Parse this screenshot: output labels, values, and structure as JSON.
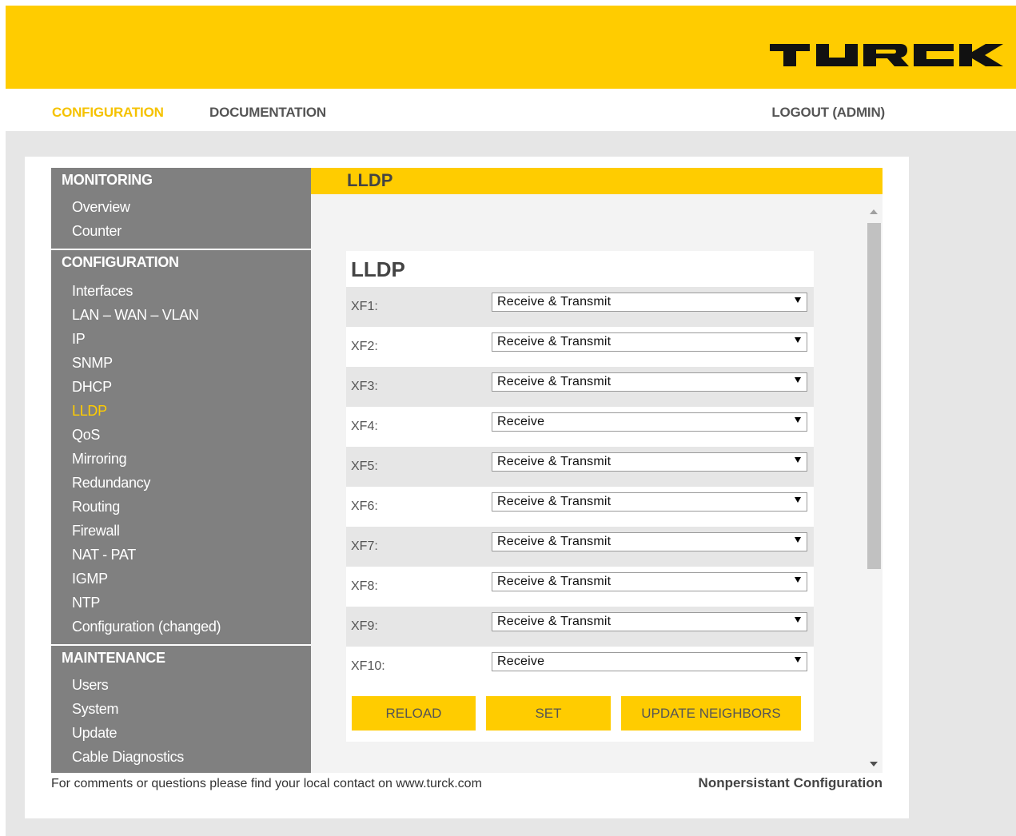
{
  "brand": {
    "logo_text": "TURCK",
    "accent": "#ffcc00",
    "sidebar_bg": "#808080"
  },
  "nav": {
    "configuration": "CONFIGURATION",
    "documentation": "DOCUMENTATION",
    "logout": "LOGOUT (ADMIN)"
  },
  "sidebar": {
    "monitoring": {
      "title": "MONITORING",
      "items": [
        "Overview",
        "Counter"
      ]
    },
    "configuration": {
      "title": "CONFIGURATION",
      "items": [
        "Interfaces",
        "LAN – WAN – VLAN",
        "IP",
        "SNMP",
        "DHCP",
        "LLDP",
        "QoS",
        "Mirroring",
        "Redundancy",
        "Routing",
        "Firewall",
        "NAT - PAT",
        "IGMP",
        "NTP",
        "Configuration (changed)"
      ],
      "active": "LLDP"
    },
    "maintenance": {
      "title": "MAINTENANCE",
      "items": [
        "Users",
        "System",
        "Update",
        "Cable Diagnostics"
      ]
    }
  },
  "content": {
    "header": "LLDP",
    "form_title": "LLDP",
    "ports": [
      {
        "label": "XF1:",
        "value": "Receive & Transmit"
      },
      {
        "label": "XF2:",
        "value": "Receive & Transmit"
      },
      {
        "label": "XF3:",
        "value": "Receive & Transmit"
      },
      {
        "label": "XF4:",
        "value": "Receive"
      },
      {
        "label": "XF5:",
        "value": "Receive & Transmit"
      },
      {
        "label": "XF6:",
        "value": "Receive & Transmit"
      },
      {
        "label": "XF7:",
        "value": "Receive & Transmit"
      },
      {
        "label": "XF8:",
        "value": "Receive & Transmit"
      },
      {
        "label": "XF9:",
        "value": "Receive & Transmit"
      },
      {
        "label": "XF10:",
        "value": "Receive"
      }
    ],
    "buttons": {
      "reload": "RELOAD",
      "set": "SET",
      "update": "UPDATE NEIGHBORS"
    }
  },
  "footer": {
    "left": "For comments or questions please find your local contact on www.turck.com",
    "right": "Nonpersistant Configuration"
  }
}
